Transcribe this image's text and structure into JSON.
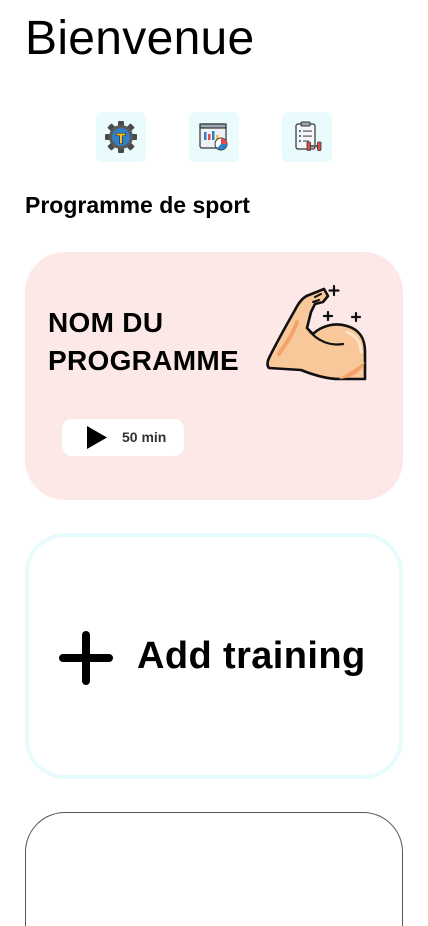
{
  "header": {
    "title": "Bienvenue"
  },
  "quick_actions": [
    {
      "icon": "gear-icon",
      "label": ""
    },
    {
      "icon": "stats-report-icon",
      "label": ""
    },
    {
      "icon": "workout-plan-icon",
      "label": ""
    }
  ],
  "section": {
    "title": "Programme de sport"
  },
  "program_card": {
    "name": "NOM DU PROGRAMME",
    "duration": "50 min",
    "icon": "flexed-bicep-icon",
    "background": "#fde8e8"
  },
  "add_card": {
    "label": "Add training",
    "icon": "plus-icon",
    "border_color": "#e7fbfd"
  },
  "colors": {
    "icon_tile_bg": "#e9fbfd",
    "accent_blue": "#2f80c9",
    "skin": "#f8c89a"
  }
}
